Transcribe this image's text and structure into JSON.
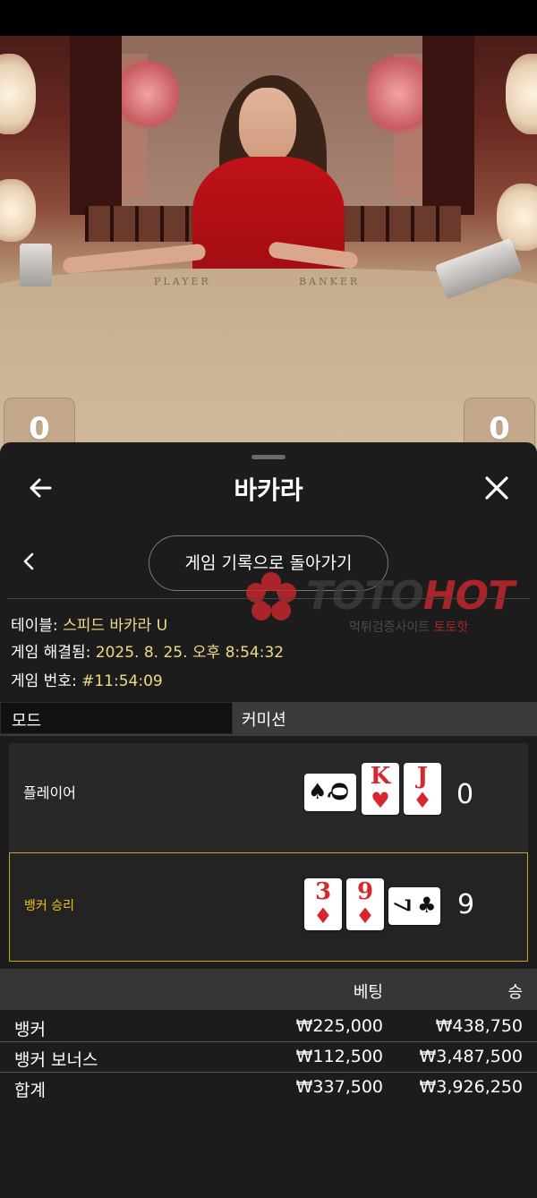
{
  "video": {
    "table_labels": {
      "player": "PLAYER",
      "banker": "BANKER"
    },
    "player_score": "0",
    "banker_score": "0"
  },
  "header": {
    "title": "바카라",
    "back_icon": "arrow-left-icon",
    "close_icon": "close-icon"
  },
  "history_button": {
    "label": "게임 기록으로 돌아가기",
    "chevron_icon": "chevron-left-icon"
  },
  "watermark": {
    "brand_a": "TOTO",
    "brand_b": "HOT",
    "sub_a": "먹튀검증사이트 ",
    "sub_b": "토토핫"
  },
  "info": {
    "table_label": "테이블: ",
    "table_value": "스피드 바카라 U",
    "resolved_label": "게임 해결됨: ",
    "resolved_value": "2025. 8. 25. 오후 8:54:32",
    "number_label": "게임 번호: ",
    "number_value": "#11:54:09"
  },
  "mode": {
    "label": "모드",
    "value": "커미션"
  },
  "hands": {
    "player": {
      "label": "플레이어",
      "score": "0",
      "cards": [
        {
          "rank": "Q",
          "suit": "♠",
          "color": "black",
          "orientation": "sideways"
        },
        {
          "rank": "K",
          "suit": "♥",
          "color": "red",
          "orientation": "upright"
        },
        {
          "rank": "J",
          "suit": "♦",
          "color": "red",
          "orientation": "upright"
        }
      ]
    },
    "banker": {
      "label": "뱅커 승리",
      "score": "9",
      "cards": [
        {
          "rank": "3",
          "suit": "♦",
          "color": "red",
          "orientation": "upright"
        },
        {
          "rank": "9",
          "suit": "♦",
          "color": "red",
          "orientation": "upright"
        },
        {
          "rank": "7",
          "suit": "♣",
          "color": "black",
          "orientation": "sideways"
        }
      ]
    }
  },
  "bets": {
    "columns": {
      "bet": "베팅",
      "win": "승"
    },
    "rows": [
      {
        "name": "뱅커",
        "bet": "₩225,000",
        "win": "₩438,750"
      },
      {
        "name": "뱅커 보너스",
        "bet": "₩112,500",
        "win": "₩3,487,500"
      },
      {
        "name": "합계",
        "bet": "₩337,500",
        "win": "₩3,926,250"
      }
    ]
  },
  "colors": {
    "highlight": "#f1c40f",
    "info_value": "#f0d98a",
    "card_red": "#d6272e",
    "brand_red": "#c8272c"
  }
}
